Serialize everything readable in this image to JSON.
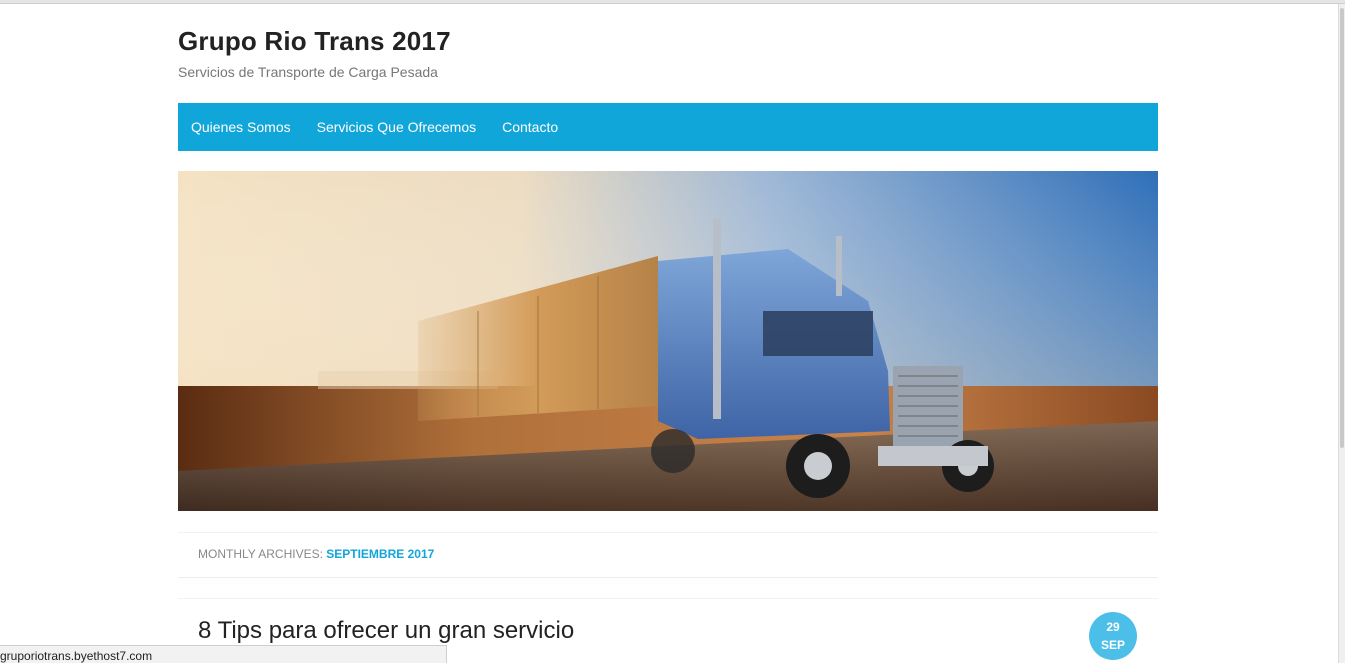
{
  "site": {
    "title": "Grupo Rio Trans 2017",
    "description": "Servicios de Transporte de Carga Pesada"
  },
  "nav": {
    "items": [
      {
        "label": "Quienes Somos"
      },
      {
        "label": "Servicios Que Ofrecemos"
      },
      {
        "label": "Contacto"
      }
    ]
  },
  "archive": {
    "prefix": "MONTHLY ARCHIVES: ",
    "month": "SEPTIEMBRE 2017"
  },
  "post": {
    "title": "8 Tips para ofrecer un gran servicio",
    "date_day": "29",
    "date_month": "SEP"
  },
  "status_bar": {
    "url": "gruporiotrans.byethost7.com"
  },
  "colors": {
    "nav_bg": "#11a6da",
    "accent": "#11a6da",
    "badge": "#4bbfe8"
  }
}
